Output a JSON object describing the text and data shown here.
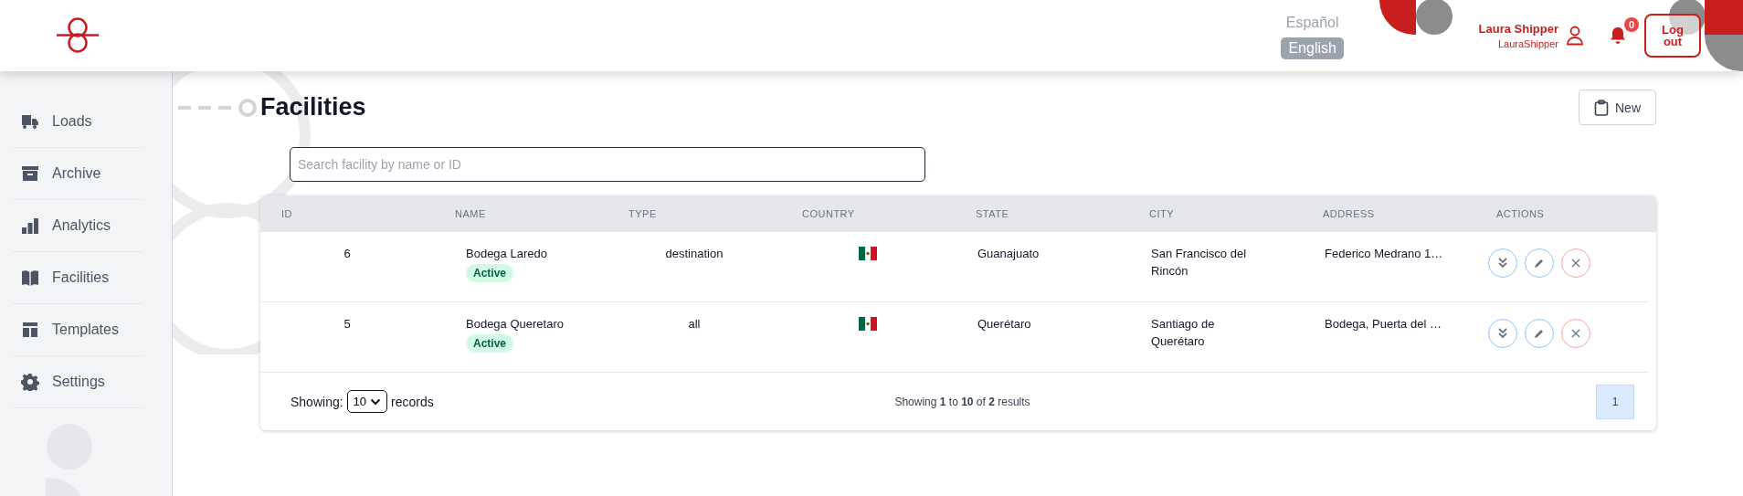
{
  "header": {
    "languages": [
      {
        "label": "Español",
        "selected": false
      },
      {
        "label": "English",
        "selected": true
      }
    ],
    "user": {
      "name": "Laura Shipper",
      "username": "LauraShipper"
    },
    "notifications": {
      "count": "0"
    },
    "logout": "Log out"
  },
  "sidebar": {
    "items": [
      {
        "label": "Loads",
        "kind": "truck",
        "selected": false
      },
      {
        "label": "Archive",
        "kind": "archive",
        "selected": false
      },
      {
        "label": "Analytics",
        "kind": "chart",
        "selected": false
      },
      {
        "label": "Facilities",
        "kind": "book",
        "selected": false
      },
      {
        "label": "Templates",
        "kind": "template",
        "selected": false
      },
      {
        "label": "Settings",
        "kind": "gear",
        "selected": false
      }
    ]
  },
  "page": {
    "title": "Facilities",
    "new_button": "New",
    "search": {
      "placeholder": "Search facility by name or ID"
    }
  },
  "table": {
    "columns": [
      "ID",
      "NAME",
      "TYPE",
      "COUNTRY",
      "STATE",
      "CITY",
      "ADDRESS",
      "ACTIONS"
    ],
    "rows": [
      {
        "id": "6",
        "name": "Bodega Laredo",
        "status": "Active",
        "type": "destination",
        "state": "Guanajuato",
        "city": "San Francisco del Rincón",
        "address": "Federico Medrano 1…"
      },
      {
        "id": "5",
        "name": "Bodega Queretaro",
        "status": "Active",
        "type": "all",
        "state": "Querétaro",
        "city": "Santiago de Querétaro",
        "address": "Bodega, Puerta del …"
      }
    ],
    "footer": {
      "showing_label": "Showing:",
      "page_size": "10",
      "records_label": "records",
      "summary": "Showing **1** to **10** of **2** results",
      "pages": [
        {
          "label": "1",
          "selected": true
        }
      ]
    }
  }
}
